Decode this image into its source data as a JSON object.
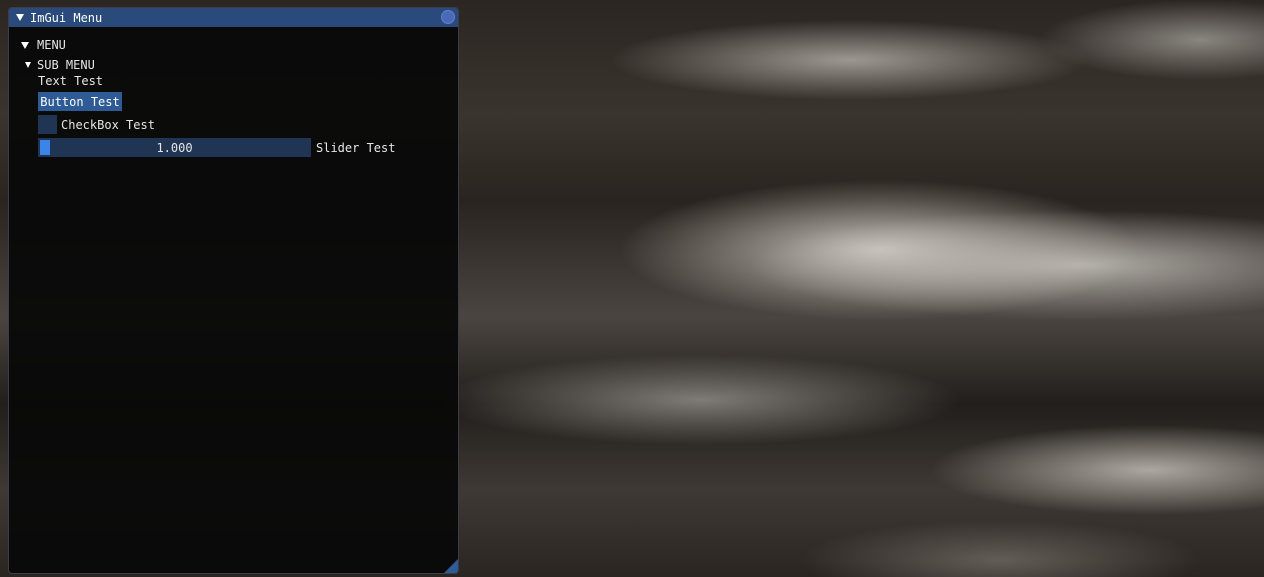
{
  "window": {
    "title": "ImGui Menu"
  },
  "menu": {
    "header_label": "MENU",
    "submenu": {
      "header_label": "SUB MENU",
      "text_label": "Text Test",
      "button_label": "Button Test",
      "checkbox_label": "CheckBox Test",
      "checkbox_checked": false,
      "slider_value_text": "1.000",
      "slider_value": 1.0,
      "slider_label": "Slider Test"
    }
  },
  "colors": {
    "title_bar": "#294a7a",
    "button": "#2e5a96",
    "frame_bg": "#203454",
    "slider_grab": "#3d84e8",
    "window_bg": "#080808"
  },
  "icons": {
    "collapse": "triangle-down-icon",
    "close": "close-circle-icon",
    "resize": "resize-grip-icon"
  }
}
